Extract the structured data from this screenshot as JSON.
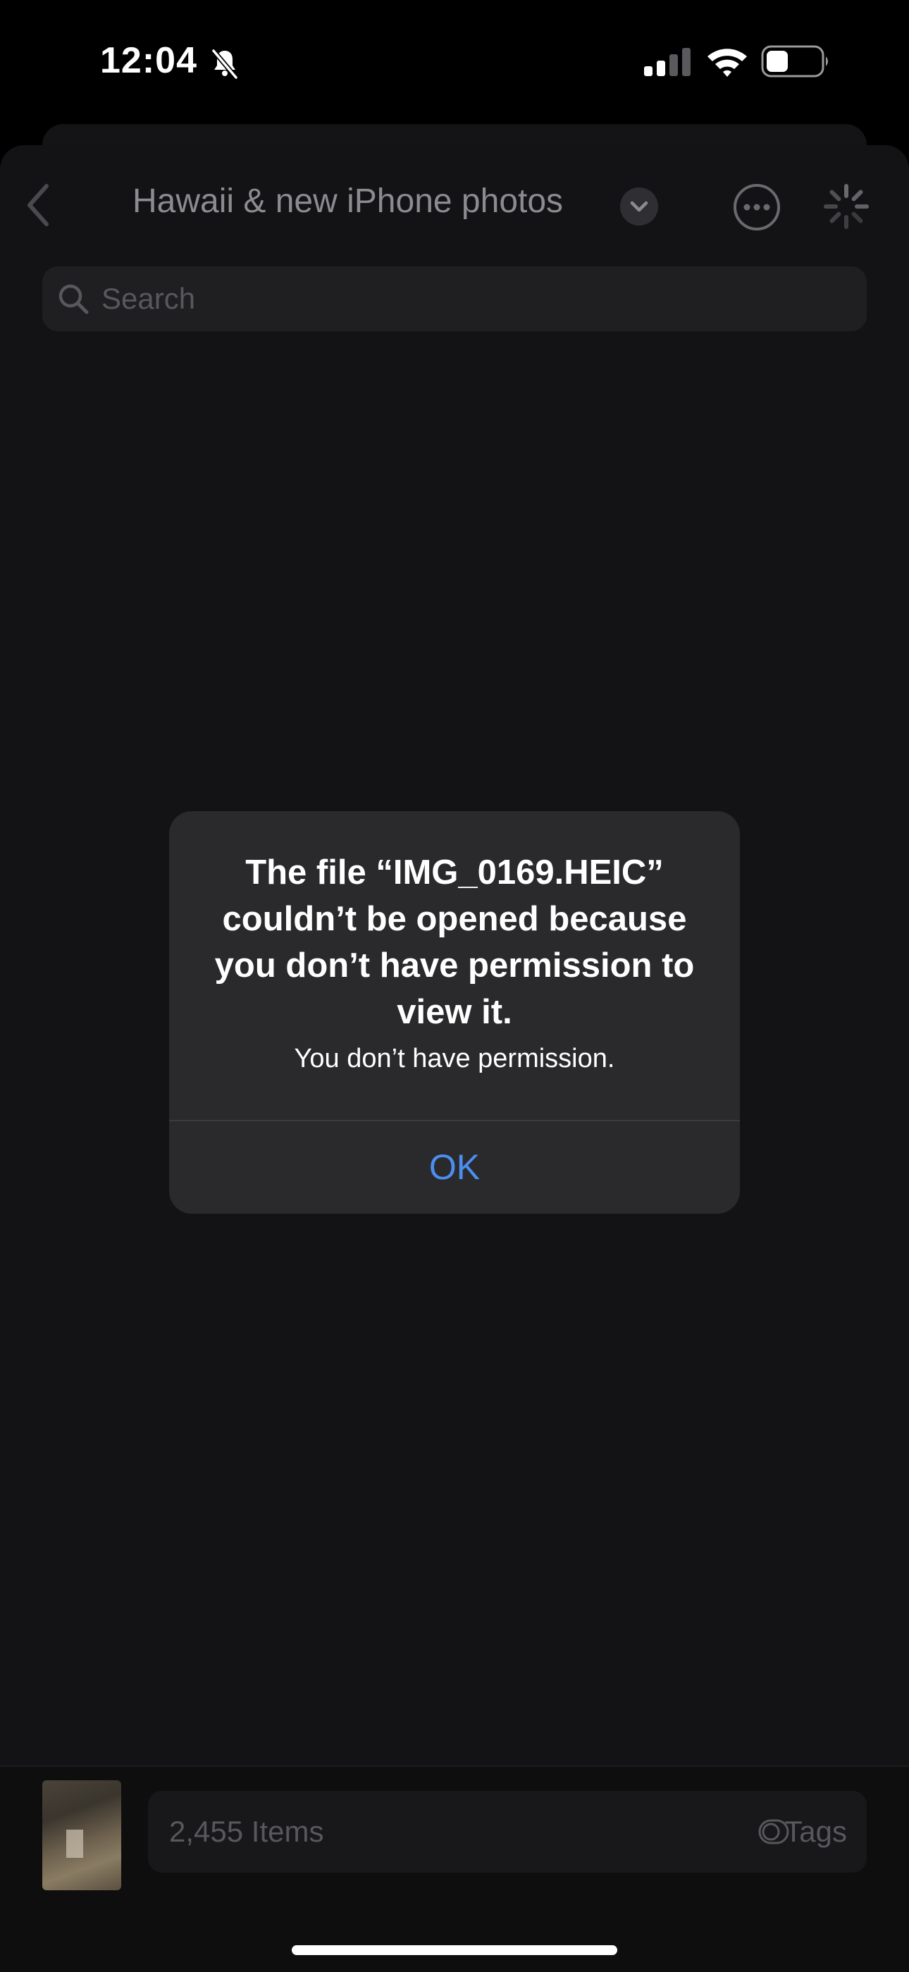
{
  "status_bar": {
    "time": "12:04"
  },
  "nav": {
    "title": "Hawaii & new iPhone photos"
  },
  "search": {
    "placeholder": "Search"
  },
  "bottom_bar": {
    "items_count": "2,455 Items",
    "tags_label": "Tags"
  },
  "alert": {
    "title": "The file “IMG_0169.HEIC” couldn’t be opened because you don’t have permission to view it.",
    "message": "You don’t have permission.",
    "ok_label": "OK"
  },
  "colors": {
    "accent": "#4b8ef0",
    "background": "#131315",
    "alert_bg": "#2a2a2c"
  }
}
